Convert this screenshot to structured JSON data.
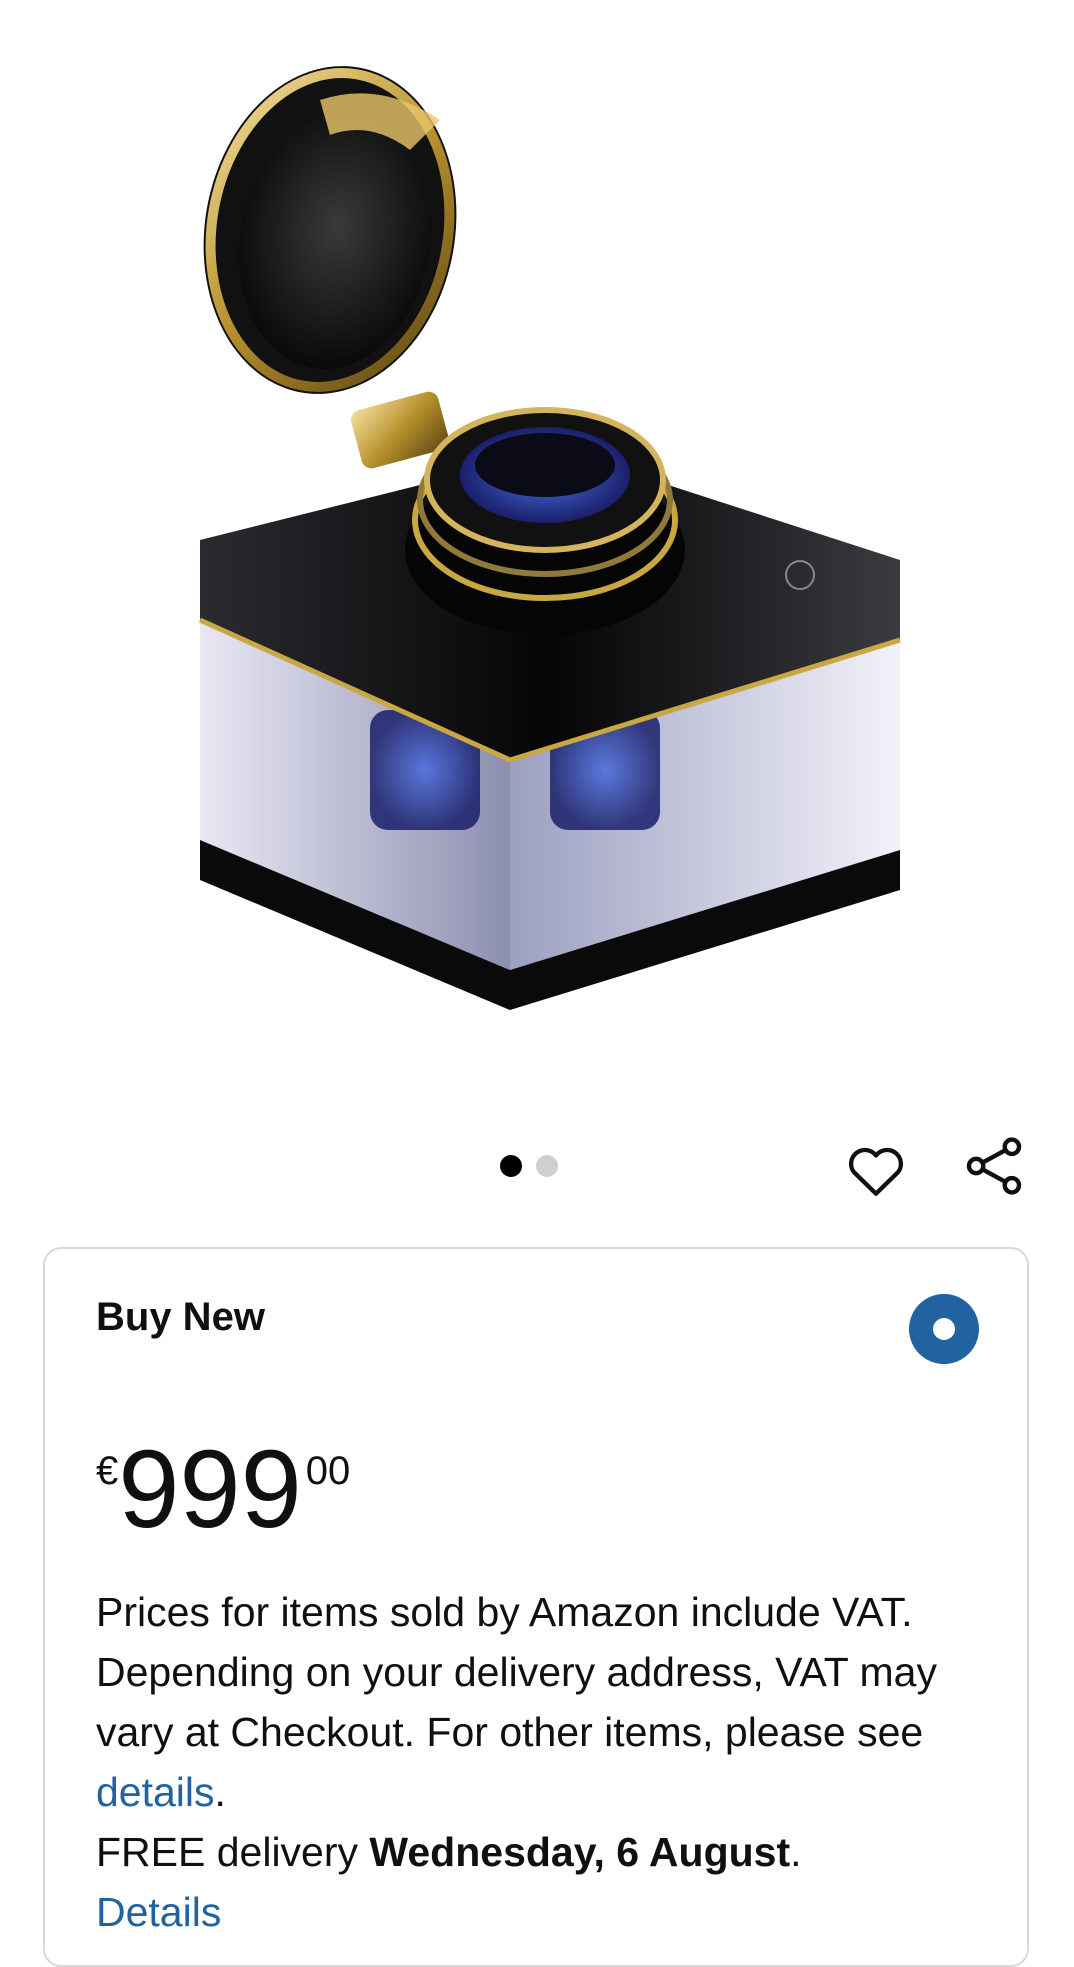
{
  "top_cut_text": "— — — —   — — — —",
  "gallery": {
    "current_index": 1,
    "total": 2
  },
  "icons": {
    "wishlist": "heart-icon",
    "share": "share-icon"
  },
  "offer": {
    "title": "Buy New",
    "selected": true,
    "price": {
      "symbol": "€",
      "whole": "999",
      "fraction": "00"
    },
    "vat_text": "Prices for items sold by Amazon include VAT. Depending on your delivery address, VAT may vary at Checkout. For other items, please see ",
    "vat_link": "details",
    "vat_end": ".",
    "delivery_prefix": "FREE delivery ",
    "delivery_date": "Wednesday, 6 August",
    "delivery_end": ".",
    "details_link": "Details"
  },
  "colors": {
    "link": "#2162a1",
    "radio": "#2162a1",
    "border": "#d5d9d9",
    "text": "#0f1111"
  }
}
